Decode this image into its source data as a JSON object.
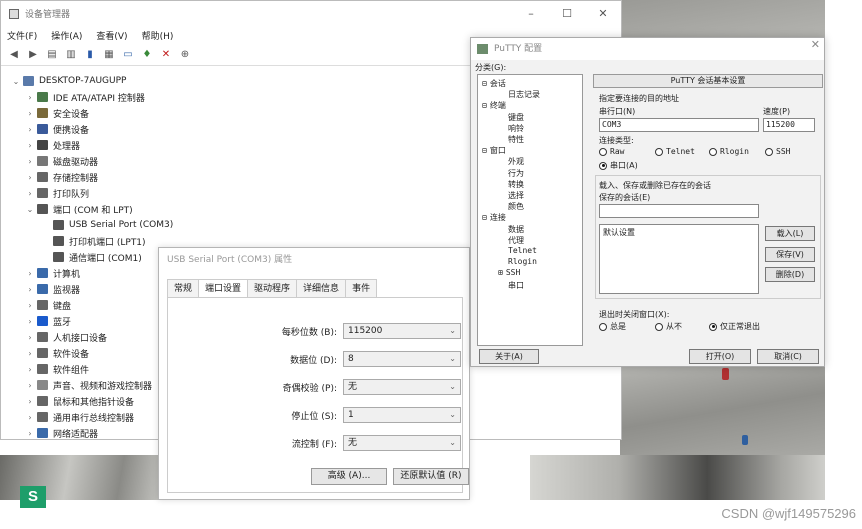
{
  "device_manager": {
    "title": "设备管理器",
    "window_controls": [
      "–",
      "☐",
      "✕"
    ],
    "menu": [
      "文件(F)",
      "操作(A)",
      "查看(V)",
      "帮助(H)"
    ],
    "tree_root": "DESKTOP-7AUGUPP",
    "tree": [
      {
        "label": "IDE ATA/ATAPI 控制器",
        "arrow": "›",
        "color": "#4a7a4a"
      },
      {
        "label": "安全设备",
        "arrow": "›",
        "color": "#7a6a3a"
      },
      {
        "label": "便携设备",
        "arrow": "›",
        "color": "#3a5a9a"
      },
      {
        "label": "处理器",
        "arrow": "›",
        "color": "#444444"
      },
      {
        "label": "磁盘驱动器",
        "arrow": "›",
        "color": "#777777"
      },
      {
        "label": "存储控制器",
        "arrow": "›",
        "color": "#666666"
      },
      {
        "label": "打印队列",
        "arrow": "›",
        "color": "#666666"
      },
      {
        "label": "端口 (COM 和 LPT)",
        "arrow": "⌄",
        "color": "#555555"
      },
      {
        "label": "USB Serial Port (COM3)",
        "arrow": "",
        "color": "#555555",
        "indent": true
      },
      {
        "label": "打印机端口 (LPT1)",
        "arrow": "",
        "color": "#555555",
        "indent": true
      },
      {
        "label": "通信端口 (COM1)",
        "arrow": "",
        "color": "#555555",
        "indent": true
      },
      {
        "label": "计算机",
        "arrow": "›",
        "color": "#3a6aaa"
      },
      {
        "label": "监视器",
        "arrow": "›",
        "color": "#3a6aaa"
      },
      {
        "label": "键盘",
        "arrow": "›",
        "color": "#666666"
      },
      {
        "label": "蓝牙",
        "arrow": "›",
        "color": "#1a5acc"
      },
      {
        "label": "人机接口设备",
        "arrow": "›",
        "color": "#666666"
      },
      {
        "label": "软件设备",
        "arrow": "›",
        "color": "#666666"
      },
      {
        "label": "软件组件",
        "arrow": "›",
        "color": "#666666"
      },
      {
        "label": "声音、视频和游戏控制器",
        "arrow": "›",
        "color": "#888888"
      },
      {
        "label": "鼠标和其他指针设备",
        "arrow": "›",
        "color": "#666666"
      },
      {
        "label": "通用串行总线控制器",
        "arrow": "›",
        "color": "#666666"
      },
      {
        "label": "网络适配器",
        "arrow": "›",
        "color": "#3a6aaa"
      }
    ]
  },
  "properties": {
    "title": "USB Serial Port (COM3) 属性",
    "tabs": [
      "常规",
      "端口设置",
      "驱动程序",
      "详细信息",
      "事件"
    ],
    "active_tab": "端口设置",
    "fields": [
      {
        "label": "每秒位数 (B):",
        "value": "115200"
      },
      {
        "label": "数据位 (D):",
        "value": "8"
      },
      {
        "label": "奇偶校验 (P):",
        "value": "无"
      },
      {
        "label": "停止位 (S):",
        "value": "1"
      },
      {
        "label": "流控制 (F):",
        "value": "无"
      }
    ],
    "advanced_button": "高级 (A)...",
    "restore_button": "还原默认值 (R)"
  },
  "putty": {
    "title": "PuTTY 配置",
    "category_label": "分类(G):",
    "categories": [
      {
        "label": "会话",
        "level": 0,
        "expander": "⊟"
      },
      {
        "label": "日志记录",
        "level": 1
      },
      {
        "label": "终端",
        "level": 0,
        "expander": "⊟"
      },
      {
        "label": "键盘",
        "level": 1
      },
      {
        "label": "响铃",
        "level": 1
      },
      {
        "label": "特性",
        "level": 1
      },
      {
        "label": "窗口",
        "level": 0,
        "expander": "⊟"
      },
      {
        "label": "外观",
        "level": 1
      },
      {
        "label": "行为",
        "level": 1
      },
      {
        "label": "转换",
        "level": 1
      },
      {
        "label": "选择",
        "level": 1
      },
      {
        "label": "颜色",
        "level": 1
      },
      {
        "label": "连接",
        "level": 0,
        "expander": "⊟"
      },
      {
        "label": "数据",
        "level": 1
      },
      {
        "label": "代理",
        "level": 1
      },
      {
        "label": "Telnet",
        "level": 1
      },
      {
        "label": "Rlogin",
        "level": 1
      },
      {
        "label": "SSH",
        "level": 1,
        "expander": "⊞"
      },
      {
        "label": "串口",
        "level": 1
      }
    ],
    "header": "PuTTY 会话基本设置",
    "dest_label": "指定要连接的目的地址",
    "serial_line_label": "串行口(N)",
    "speed_label": "速度(P)",
    "serial_line_value": "COM3",
    "speed_value": "115200",
    "conn_type_label": "连接类型:",
    "conn_types": [
      {
        "label": "Raw",
        "checked": false
      },
      {
        "label": "Telnet",
        "checked": false
      },
      {
        "label": "Rlogin",
        "checked": false
      },
      {
        "label": "SSH",
        "checked": false
      },
      {
        "label": "串口(A)",
        "checked": true
      }
    ],
    "sessions_group_label": "载入、保存或删除已存在的会话",
    "saved_sessions_label": "保存的会话(E)",
    "saved_sessions_input": "",
    "sessions_list": [
      "默认设置"
    ],
    "load_button": "载入(L)",
    "save_button": "保存(V)",
    "delete_button": "删除(D)",
    "close_on_exit_label": "退出时关闭窗口(X):",
    "close_options": [
      {
        "label": "总是",
        "checked": false
      },
      {
        "label": "从不",
        "checked": false
      },
      {
        "label": "仅正常退出",
        "checked": true
      }
    ],
    "about_button": "关于(A)",
    "open_button": "打开(O)",
    "cancel_button": "取消(C)"
  },
  "taskbar_letter": "S",
  "watermark": "CSDN @wjf149575296"
}
